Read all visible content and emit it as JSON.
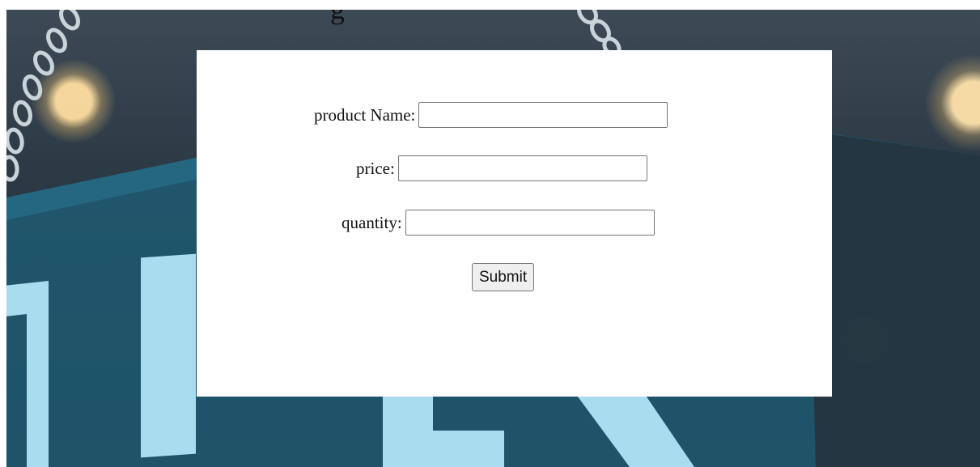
{
  "page": {
    "heading_fragment": "g"
  },
  "background": {
    "sign_letters": [
      "O",
      "P",
      "E",
      "N"
    ],
    "colors": {
      "dark": "#24333d",
      "sign_board": "#1f5b72",
      "letters": "#a9dcef",
      "bokeh": "#ffdca0"
    }
  },
  "form": {
    "product_name_label": "product Name:",
    "product_name_value": "",
    "price_label": "price:",
    "price_value": "",
    "quantity_label": "quantity:",
    "quantity_value": "",
    "submit_label": "Submit"
  }
}
